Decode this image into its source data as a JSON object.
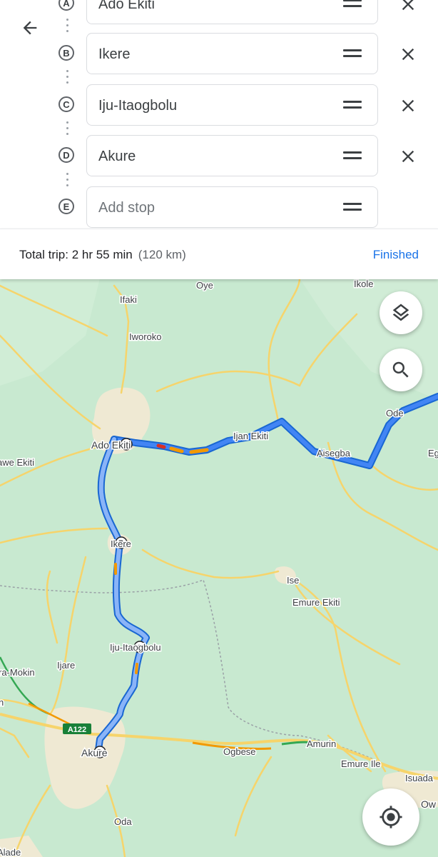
{
  "stops": [
    {
      "letter": "A",
      "value": "Ado Ekiti",
      "is_placeholder": false
    },
    {
      "letter": "B",
      "value": "Ikere",
      "is_placeholder": false
    },
    {
      "letter": "C",
      "value": "Iju-Itaogbolu",
      "is_placeholder": false
    },
    {
      "letter": "D",
      "value": "Akure",
      "is_placeholder": false
    },
    {
      "letter": "E",
      "value": "Add stop",
      "is_placeholder": true
    }
  ],
  "summary": {
    "total_trip": "Total trip: 2 hr 55 min",
    "distance": "(120 km)",
    "finished_label": "Finished"
  },
  "map": {
    "labels": {
      "oye": "Oye",
      "ikole": "Ikole",
      "ifaki": "Ifaki",
      "iworoko": "Iworoko",
      "ado": "Ado Ekiti",
      "ijan": "Ijan Ekiti",
      "aisegba": "Aisegba",
      "ode": "Ode",
      "eg": "Eg",
      "awe": "awe Ekiti",
      "ikere": "Ikere",
      "ise": "Ise",
      "emure": "Emure Ekiti",
      "iju": "Iju-Itaogbolu",
      "ijare": "Ijare",
      "mokin": "ra-Mokin",
      "n": "n",
      "akure": "Akure",
      "ogbese": "Ogbese",
      "amurin": "Amurin",
      "emureile": "Emure Ile",
      "isuada": "Isuada",
      "ow": "Ow",
      "oda": "Oda",
      "alade": "Alade",
      "a122": "A122"
    },
    "route_color": "#4285f4",
    "traffic_slow_color": "#f29900",
    "traffic_heavy_color": "#d93025",
    "road_color": "#f6d46b"
  },
  "icons": {
    "back": "arrow-back-icon",
    "layers": "layers-icon",
    "search": "search-icon",
    "location": "my-location-icon"
  }
}
